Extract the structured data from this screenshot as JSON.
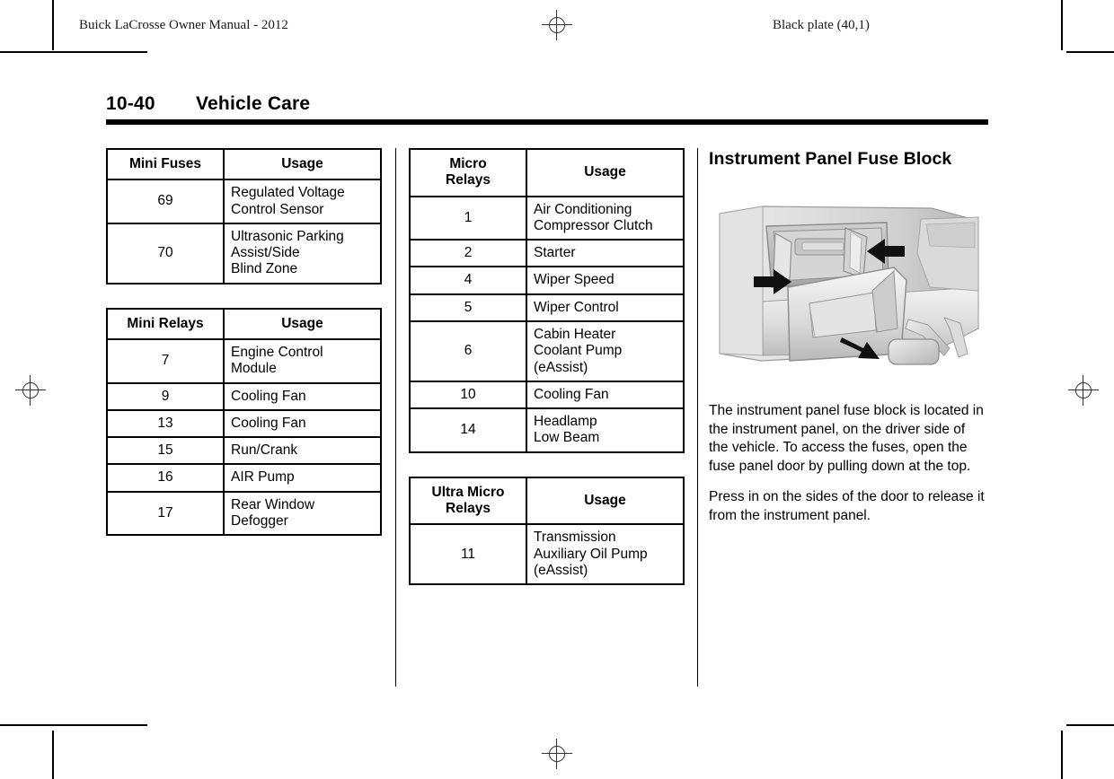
{
  "page": {
    "running_head_left": "Buick LaCrosse Owner Manual - 2012",
    "running_head_right": "Black plate (40,1)",
    "page_number": "10-40",
    "chapter_title": "Vehicle Care"
  },
  "tables": [
    {
      "id": "mini-fuses",
      "headers": [
        "Mini Fuses",
        "Usage"
      ],
      "rows": [
        {
          "id": "69",
          "usage": "Regulated Voltage\nControl Sensor"
        },
        {
          "id": "70",
          "usage": "Ultrasonic Parking\nAssist/Side\nBlind Zone"
        }
      ]
    },
    {
      "id": "mini-relays",
      "headers": [
        "Mini Relays",
        "Usage"
      ],
      "rows": [
        {
          "id": "7",
          "usage": "Engine Control\nModule"
        },
        {
          "id": "9",
          "usage": "Cooling Fan"
        },
        {
          "id": "13",
          "usage": "Cooling Fan"
        },
        {
          "id": "15",
          "usage": "Run/Crank"
        },
        {
          "id": "16",
          "usage": "AIR Pump"
        },
        {
          "id": "17",
          "usage": "Rear Window\nDefogger"
        }
      ]
    },
    {
      "id": "micro-relays",
      "headers": [
        "Micro\nRelays",
        "Usage"
      ],
      "rows": [
        {
          "id": "1",
          "usage": "Air Conditioning\nCompressor Clutch"
        },
        {
          "id": "2",
          "usage": "Starter"
        },
        {
          "id": "4",
          "usage": "Wiper Speed"
        },
        {
          "id": "5",
          "usage": "Wiper Control"
        },
        {
          "id": "6",
          "usage": "Cabin Heater\nCoolant Pump\n(eAssist)"
        },
        {
          "id": "10",
          "usage": "Cooling Fan"
        },
        {
          "id": "14",
          "usage": "Headlamp\nLow Beam"
        }
      ]
    },
    {
      "id": "ultra-micro-relays",
      "headers": [
        "Ultra Micro\nRelays",
        "Usage"
      ],
      "rows": [
        {
          "id": "11",
          "usage": "Transmission\nAuxiliary Oil Pump\n(eAssist)"
        }
      ]
    }
  ],
  "right_column": {
    "heading": "Instrument Panel Fuse Block",
    "figure_name": "instrument-panel-fuse-block-illustration",
    "paragraphs": [
      "The instrument panel fuse block is located in the instrument panel, on the driver side of the vehicle. To access the fuses, open the fuse panel door by pulling down at the top.",
      "Press in on the sides of the door to release it from the instrument panel."
    ]
  },
  "colors": {
    "text": "#000000",
    "rule": "#000000",
    "crop_mark": "#000000",
    "illustration_light": "#e8e8e8",
    "illustration_mid": "#c2c2c2",
    "illustration_dark": "#8f8f8f",
    "arrow": "#111111"
  }
}
